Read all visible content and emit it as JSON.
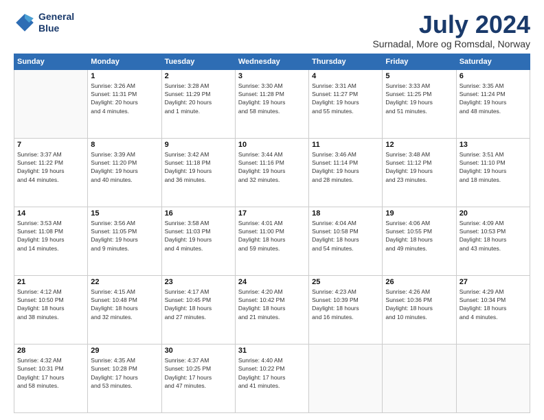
{
  "header": {
    "logo_line1": "General",
    "logo_line2": "Blue",
    "month": "July 2024",
    "location": "Surnadal, More og Romsdal, Norway"
  },
  "days_of_week": [
    "Sunday",
    "Monday",
    "Tuesday",
    "Wednesday",
    "Thursday",
    "Friday",
    "Saturday"
  ],
  "weeks": [
    [
      {
        "day": "",
        "info": ""
      },
      {
        "day": "1",
        "info": "Sunrise: 3:26 AM\nSunset: 11:31 PM\nDaylight: 20 hours\nand 4 minutes."
      },
      {
        "day": "2",
        "info": "Sunrise: 3:28 AM\nSunset: 11:29 PM\nDaylight: 20 hours\nand 1 minute."
      },
      {
        "day": "3",
        "info": "Sunrise: 3:30 AM\nSunset: 11:28 PM\nDaylight: 19 hours\nand 58 minutes."
      },
      {
        "day": "4",
        "info": "Sunrise: 3:31 AM\nSunset: 11:27 PM\nDaylight: 19 hours\nand 55 minutes."
      },
      {
        "day": "5",
        "info": "Sunrise: 3:33 AM\nSunset: 11:25 PM\nDaylight: 19 hours\nand 51 minutes."
      },
      {
        "day": "6",
        "info": "Sunrise: 3:35 AM\nSunset: 11:24 PM\nDaylight: 19 hours\nand 48 minutes."
      }
    ],
    [
      {
        "day": "7",
        "info": "Sunrise: 3:37 AM\nSunset: 11:22 PM\nDaylight: 19 hours\nand 44 minutes."
      },
      {
        "day": "8",
        "info": "Sunrise: 3:39 AM\nSunset: 11:20 PM\nDaylight: 19 hours\nand 40 minutes."
      },
      {
        "day": "9",
        "info": "Sunrise: 3:42 AM\nSunset: 11:18 PM\nDaylight: 19 hours\nand 36 minutes."
      },
      {
        "day": "10",
        "info": "Sunrise: 3:44 AM\nSunset: 11:16 PM\nDaylight: 19 hours\nand 32 minutes."
      },
      {
        "day": "11",
        "info": "Sunrise: 3:46 AM\nSunset: 11:14 PM\nDaylight: 19 hours\nand 28 minutes."
      },
      {
        "day": "12",
        "info": "Sunrise: 3:48 AM\nSunset: 11:12 PM\nDaylight: 19 hours\nand 23 minutes."
      },
      {
        "day": "13",
        "info": "Sunrise: 3:51 AM\nSunset: 11:10 PM\nDaylight: 19 hours\nand 18 minutes."
      }
    ],
    [
      {
        "day": "14",
        "info": "Sunrise: 3:53 AM\nSunset: 11:08 PM\nDaylight: 19 hours\nand 14 minutes."
      },
      {
        "day": "15",
        "info": "Sunrise: 3:56 AM\nSunset: 11:05 PM\nDaylight: 19 hours\nand 9 minutes."
      },
      {
        "day": "16",
        "info": "Sunrise: 3:58 AM\nSunset: 11:03 PM\nDaylight: 19 hours\nand 4 minutes."
      },
      {
        "day": "17",
        "info": "Sunrise: 4:01 AM\nSunset: 11:00 PM\nDaylight: 18 hours\nand 59 minutes."
      },
      {
        "day": "18",
        "info": "Sunrise: 4:04 AM\nSunset: 10:58 PM\nDaylight: 18 hours\nand 54 minutes."
      },
      {
        "day": "19",
        "info": "Sunrise: 4:06 AM\nSunset: 10:55 PM\nDaylight: 18 hours\nand 49 minutes."
      },
      {
        "day": "20",
        "info": "Sunrise: 4:09 AM\nSunset: 10:53 PM\nDaylight: 18 hours\nand 43 minutes."
      }
    ],
    [
      {
        "day": "21",
        "info": "Sunrise: 4:12 AM\nSunset: 10:50 PM\nDaylight: 18 hours\nand 38 minutes."
      },
      {
        "day": "22",
        "info": "Sunrise: 4:15 AM\nSunset: 10:48 PM\nDaylight: 18 hours\nand 32 minutes."
      },
      {
        "day": "23",
        "info": "Sunrise: 4:17 AM\nSunset: 10:45 PM\nDaylight: 18 hours\nand 27 minutes."
      },
      {
        "day": "24",
        "info": "Sunrise: 4:20 AM\nSunset: 10:42 PM\nDaylight: 18 hours\nand 21 minutes."
      },
      {
        "day": "25",
        "info": "Sunrise: 4:23 AM\nSunset: 10:39 PM\nDaylight: 18 hours\nand 16 minutes."
      },
      {
        "day": "26",
        "info": "Sunrise: 4:26 AM\nSunset: 10:36 PM\nDaylight: 18 hours\nand 10 minutes."
      },
      {
        "day": "27",
        "info": "Sunrise: 4:29 AM\nSunset: 10:34 PM\nDaylight: 18 hours\nand 4 minutes."
      }
    ],
    [
      {
        "day": "28",
        "info": "Sunrise: 4:32 AM\nSunset: 10:31 PM\nDaylight: 17 hours\nand 58 minutes."
      },
      {
        "day": "29",
        "info": "Sunrise: 4:35 AM\nSunset: 10:28 PM\nDaylight: 17 hours\nand 53 minutes."
      },
      {
        "day": "30",
        "info": "Sunrise: 4:37 AM\nSunset: 10:25 PM\nDaylight: 17 hours\nand 47 minutes."
      },
      {
        "day": "31",
        "info": "Sunrise: 4:40 AM\nSunset: 10:22 PM\nDaylight: 17 hours\nand 41 minutes."
      },
      {
        "day": "",
        "info": ""
      },
      {
        "day": "",
        "info": ""
      },
      {
        "day": "",
        "info": ""
      }
    ]
  ]
}
